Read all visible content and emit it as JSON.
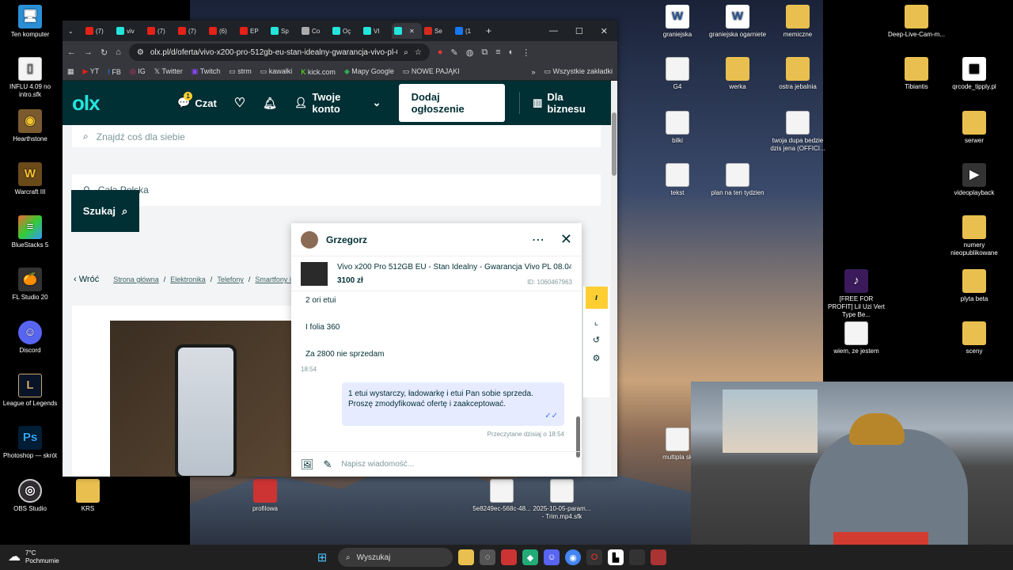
{
  "desktop": {
    "left_icons": [
      {
        "label": "Ten komputer",
        "icon": "computer-icon"
      },
      {
        "label": "INFLU 4.09 no intro.sfk",
        "icon": "file-icon"
      },
      {
        "label": "Hearthstone",
        "icon": "hearthstone-icon"
      },
      {
        "label": "Warcraft III",
        "icon": "warcraft-icon"
      },
      {
        "label": "BlueStacks 5",
        "icon": "bluestacks-icon"
      },
      {
        "label": "FL Studio 20",
        "icon": "fl-studio-icon"
      },
      {
        "label": "Discord",
        "icon": "discord-icon"
      },
      {
        "label": "League of Legends",
        "icon": "league-icon"
      },
      {
        "label": "Photoshop — skrót",
        "icon": "photoshop-icon"
      },
      {
        "label": "OBS Studio",
        "icon": "obs-icon"
      }
    ],
    "mid_icons": [
      {
        "label": "KRS"
      },
      {
        "label": "profilowa"
      },
      {
        "label": "5e8249ec-568c-48..."
      },
      {
        "label": "2025-10-05-param... - Trim.mp4.sfk"
      }
    ],
    "top_icons": [
      {
        "label": "graniejska"
      },
      {
        "label": "graniejska ogarniete"
      },
      {
        "label": "memiczne"
      },
      {
        "label": "G4"
      },
      {
        "label": "werka"
      },
      {
        "label": "ostra jebalnia"
      },
      {
        "label": "bilki"
      },
      {
        "label": "twoja dupa bedzie dzis jena (OFFICI..."
      },
      {
        "label": "tekst"
      },
      {
        "label": "plan na ten tydzien"
      },
      {
        "label": "multipla sk"
      }
    ],
    "right_icons": [
      {
        "label": "Deep-Live-Cam-m..."
      },
      {
        "label": "Tibiantis"
      },
      {
        "label": "qrcode_tipply.pl"
      },
      {
        "label": "serwer"
      },
      {
        "label": "videoplayback"
      },
      {
        "label": "numery nieopublikowane"
      },
      {
        "label": "[FREE FOR PROFIT] Lil Uzi Vert Type Be..."
      },
      {
        "label": "plyta beta"
      },
      {
        "label": "wiem, ze jestem"
      },
      {
        "label": "sceny"
      }
    ]
  },
  "browser": {
    "tabs": [
      {
        "label": "(7)",
        "color": "#e62117"
      },
      {
        "label": "viv",
        "color": "#23e5db"
      },
      {
        "label": "(7)",
        "color": "#e62117"
      },
      {
        "label": "(7)",
        "color": "#e62117"
      },
      {
        "label": "(6)",
        "color": "#e62117"
      },
      {
        "label": "EP",
        "color": "#e62117"
      },
      {
        "label": "Sp",
        "color": "#23e5db"
      },
      {
        "label": "Co",
        "color": "#aaaaaa"
      },
      {
        "label": "Oç",
        "color": "#23e5db"
      },
      {
        "label": "VI",
        "color": "#23e5db"
      },
      {
        "label": "",
        "color": "#23e5db"
      },
      {
        "label": "Se",
        "color": "#d52b1e"
      },
      {
        "label": "(1",
        "color": "#1877f2"
      }
    ],
    "url": "olx.pl/d/oferta/vivo-x200-pro-512gb-eu-stan-idealny-gwarancja-vivo-pl-08-04-...",
    "bookmarks": [
      "YT",
      "FB",
      "IG",
      "Twitter",
      "Twitch",
      "strm",
      "kawałki",
      "kick.com",
      "Mapy Google",
      "NOWE PAJĄKI"
    ],
    "all_bookmarks": "Wszystkie zakładki"
  },
  "olx": {
    "logo": "olx",
    "chat": "Czat",
    "chat_badge": "1",
    "account": "Twoje konto",
    "post_button": "Dodaj ogłoszenie",
    "business": "Dla biznesu",
    "search_placeholder": "Znajdź coś dla siebie",
    "location": "Cała Polska",
    "search_button": "Szukaj",
    "back": "Wróć",
    "breadcrumbs": [
      "Strona główna",
      "Elektronika",
      "Telefony",
      "Smartfony i tele"
    ]
  },
  "chat": {
    "name": "Grzegorz",
    "offer_title": "Vivo x200 Pro 512GB EU - Stan Idealny - Gwarancja Vivo PL 08.04...",
    "offer_price": "3100 zł",
    "offer_id": "ID: 1060467963",
    "messages": [
      "2 ori etui",
      "I folia 360",
      "Za 2800 nie sprzedam"
    ],
    "time": "18:54",
    "my_message": "1 etui wystarczy, ładowarkę i etui Pan sobie sprzeda. Proszę zmodyfikować ofertę i zaakceptować.",
    "read_status": "Przeczytane dzisiaj o 18:54",
    "input_placeholder": "Napisz wiadomość..."
  },
  "taskbar": {
    "temperature": "7°C",
    "weather": "Pochmurnie",
    "search": "Wyszukaj"
  },
  "colors": {
    "olx_dark": "#002f34",
    "olx_teal": "#23e5db",
    "my_bubble": "#e7ebff"
  }
}
